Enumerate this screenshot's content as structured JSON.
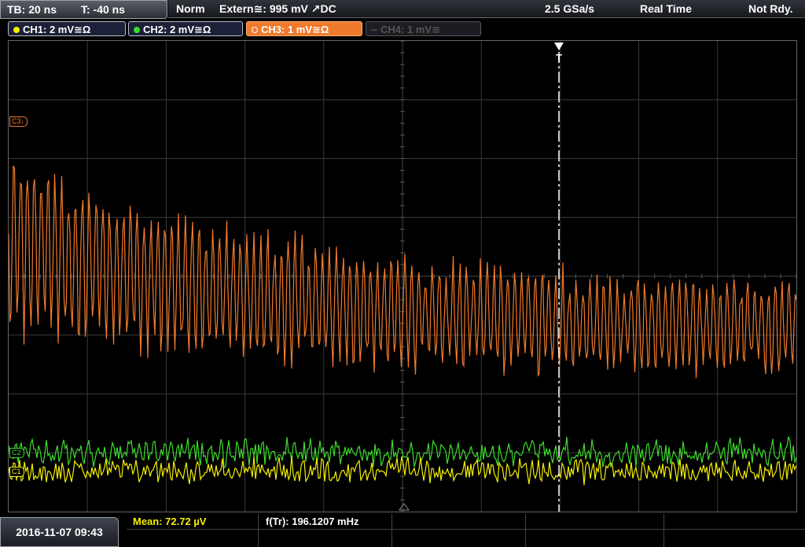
{
  "status": {
    "timebase": "TB: 20 ns",
    "trigger_time": "T: -40 ns",
    "mode": "Norm",
    "trigger_source": "Extern≅: 995 mV ↗DC",
    "sample_rate": "2.5 GSa/s",
    "acquisition": "Real Time",
    "state": "Not Rdy."
  },
  "channels": [
    {
      "label": "CH1: 2 mV≅Ω",
      "color": "#f5f000",
      "active": true
    },
    {
      "label": "CH2: 2 mV≅Ω",
      "color": "#3ddc2c",
      "active": true
    },
    {
      "label": "CH3: 1 mV≅Ω",
      "color": "#f07a2c",
      "active": true,
      "selected": true
    },
    {
      "label": "CH4: 1 mV≅",
      "color": "#555555",
      "active": false
    }
  ],
  "markers": {
    "ch3": "C3",
    "ch2": "C2",
    "ch1": "C1",
    "trigger": "T"
  },
  "bottom": {
    "datetime": "2016-11-07 09:43",
    "mean": "Mean: 72.72 µV",
    "frequency": "f(Tr): 196.1207 mHz"
  },
  "colors": {
    "ch1": "#f5f000",
    "ch2": "#3ddc2c",
    "ch3": "#f07a2c",
    "grid": "#3a3a3a"
  }
}
